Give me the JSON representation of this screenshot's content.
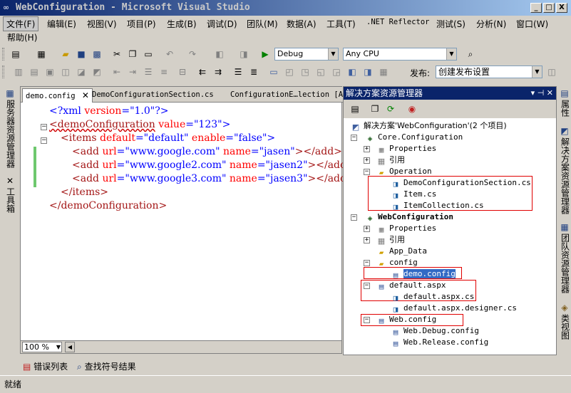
{
  "window": {
    "title": "WebConfiguration - Microsoft Visual Studio",
    "min": "_",
    "max": "□",
    "close": "X"
  },
  "menu": [
    "文件(F)",
    "编辑(E)",
    "视图(V)",
    "项目(P)",
    "生成(B)",
    "调试(D)",
    "团队(M)",
    "数据(A)",
    "工具(T)",
    ".NET Reflector",
    "测试(S)",
    "分析(N)",
    "窗口(W)"
  ],
  "menu2": [
    "帮助(H)"
  ],
  "toolbar": {
    "config": "Debug",
    "platform": "Any CPU",
    "publish_label": "发布:",
    "publish_value": "创建发布设置"
  },
  "left_tabs": [
    "服务器资源管理器",
    "工具箱"
  ],
  "right_tabs": [
    "属性",
    "解决方案资源管理器",
    "团队资源管理器",
    "类视图"
  ],
  "doc_tabs": [
    "demo.config",
    "DemoConfigurationSection.cs",
    "ConfigurationE…lection [A"
  ],
  "code": [
    [
      "<?xml",
      " version",
      "=\"1.0\"",
      "?>"
    ],
    [
      "<demoConfiguration",
      " value",
      "=\"123\"",
      ">"
    ],
    [
      "<items",
      "  default",
      "=\"default\"",
      " enable",
      "=\"false\"",
      ">"
    ],
    [
      "<add",
      "  url",
      "=\"www.google.com\"",
      "  name",
      "=\"jasen\"",
      "></add>"
    ],
    [
      "<add",
      "  url",
      "=\"www.google2.com\"",
      "  name",
      "=\"jasen2\"",
      "></add>"
    ],
    [
      "<add",
      "  url",
      "=\"www.google3.com\"",
      "  name",
      "=\"jasen3\"",
      "></add>"
    ],
    [
      "</items>"
    ],
    [
      "</demoConfiguration>"
    ]
  ],
  "zoom": "100 %",
  "solution": {
    "title": "解决方案资源管理器",
    "title_btns": "▾ ⊣ ✕",
    "root": "解决方案'WebConfiguration'(2 个项目)",
    "items": [
      {
        "text": "Core.Configuration",
        "icon": "project-icon"
      },
      {
        "text": "Properties",
        "icon": "folder-icon"
      },
      {
        "text": "引用",
        "icon": "folder-icon"
      },
      {
        "text": "Operation",
        "icon": "folder-icon"
      },
      {
        "text": "DemoConfigurationSection.cs",
        "icon": "cs-file-icon"
      },
      {
        "text": "Item.cs",
        "icon": "cs-file-icon"
      },
      {
        "text": "ItemCollection.cs",
        "icon": "cs-file-icon"
      },
      {
        "text": "WebConfiguration",
        "icon": "web-project-icon"
      },
      {
        "text": "Properties",
        "icon": "folder-icon"
      },
      {
        "text": "引用",
        "icon": "folder-icon"
      },
      {
        "text": "App_Data",
        "icon": "folder-icon"
      },
      {
        "text": "config",
        "icon": "folder-icon"
      },
      {
        "text": "demo.config",
        "icon": "config-file-icon"
      },
      {
        "text": "default.aspx",
        "icon": "aspx-file-icon"
      },
      {
        "text": "default.aspx.cs",
        "icon": "cs-file-icon"
      },
      {
        "text": "default.aspx.designer.cs",
        "icon": "cs-file-icon"
      },
      {
        "text": "Web.config",
        "icon": "config-file-icon"
      },
      {
        "text": "Web.Debug.config",
        "icon": "config-file-icon"
      },
      {
        "text": "Web.Release.config",
        "icon": "config-file-icon"
      }
    ]
  },
  "bottom_tabs": [
    "错误列表",
    "查找符号结果"
  ],
  "status": "就绪",
  "colors": {
    "title_bar": "#0a246a",
    "highlight_box": "#e00000",
    "selection": "#316ac5"
  }
}
